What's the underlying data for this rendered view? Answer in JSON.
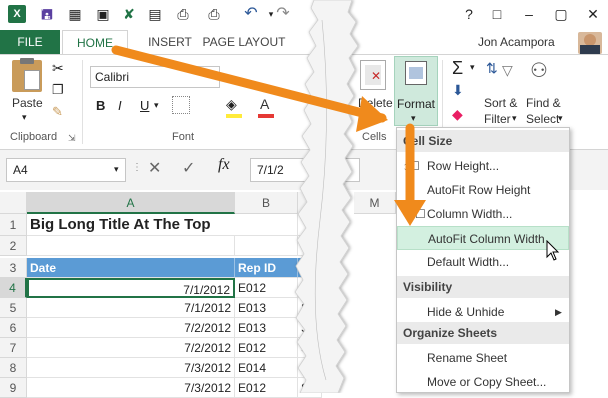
{
  "qat": {
    "icons": [
      "excel-logo-icon",
      "save-icon",
      "table-icon",
      "camera-icon",
      "clear-icon",
      "print-preview-icon",
      "undo-icon",
      "redo-icon"
    ]
  },
  "tabs": {
    "file": "FILE",
    "home": "HOME",
    "insert": "INSERT",
    "page_layout": "PAGE LAYOUT"
  },
  "user": {
    "name": "Jon Acampora"
  },
  "ribbon": {
    "paste": "Paste",
    "clipboard": "Clipboard",
    "font_name": "Calibri",
    "bold": "B",
    "italic": "I",
    "underline": "U",
    "font_group": "Font",
    "delete": "Delete",
    "format": "Format",
    "cells": "Cells",
    "sort_filter": "Sort &",
    "filter": "Filter",
    "find_select": "Find &",
    "select": "Select"
  },
  "formula_bar": {
    "name_box": "A4",
    "fx": "fx",
    "value": "7/1/2"
  },
  "grid": {
    "columns": [
      "A",
      "B",
      "I",
      "M"
    ],
    "rows": [
      {
        "num": "1",
        "a": "Big Long Title At The Top",
        "b": "",
        "c": ""
      },
      {
        "num": "2",
        "a": "",
        "b": "",
        "c": ""
      },
      {
        "num": "3",
        "a": "Date",
        "b": "Rep ID",
        "c": "I"
      },
      {
        "num": "4",
        "a": "7/1/2012",
        "b": "E012",
        "c": "S"
      },
      {
        "num": "5",
        "a": "7/1/2012",
        "b": "E013",
        "c": "S"
      },
      {
        "num": "6",
        "a": "7/2/2012",
        "b": "E013",
        "c": "S"
      },
      {
        "num": "7",
        "a": "7/2/2012",
        "b": "E012",
        "c": "S"
      },
      {
        "num": "8",
        "a": "7/3/2012",
        "b": "E014",
        "c": "S"
      },
      {
        "num": "9",
        "a": "7/3/2012",
        "b": "E012",
        "c": "S"
      }
    ]
  },
  "menu": {
    "cell_size": "Cell Size",
    "row_height": "Row Height...",
    "autofit_row": "AutoFit Row Height",
    "column_width": "Column Width...",
    "autofit_column": "AutoFit Column Width",
    "default_width": "Default Width...",
    "visibility": "Visibility",
    "hide_unhide": "Hide & Unhide",
    "organize": "Organize Sheets",
    "rename": "Rename Sheet",
    "move_copy": "Move or Copy Sheet..."
  },
  "colors": {
    "excel_green": "#217346",
    "arrow_orange": "#f08a1c",
    "header_blue": "#5b9bd5",
    "highlight_green": "#d3f0e0"
  }
}
